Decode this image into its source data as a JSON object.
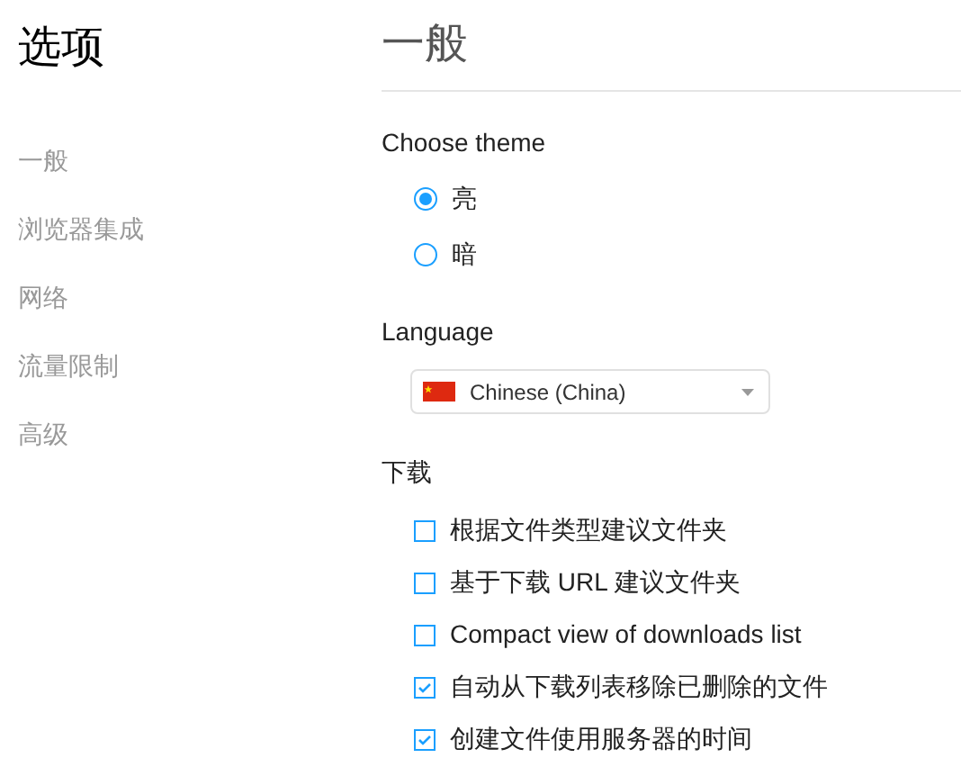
{
  "sidebar": {
    "title": "选项",
    "items": [
      {
        "label": "一般"
      },
      {
        "label": "浏览器集成"
      },
      {
        "label": "网络"
      },
      {
        "label": "流量限制"
      },
      {
        "label": "高级"
      }
    ]
  },
  "page": {
    "title": "一般",
    "theme": {
      "label": "Choose theme",
      "options": [
        {
          "label": "亮",
          "selected": true
        },
        {
          "label": "暗",
          "selected": false
        }
      ]
    },
    "language": {
      "label": "Language",
      "value": "Chinese (China)"
    },
    "downloads": {
      "label": "下载",
      "options": [
        {
          "label": "根据文件类型建议文件夹",
          "checked": false
        },
        {
          "label": "基于下载 URL 建议文件夹",
          "checked": false
        },
        {
          "label": "Compact view of downloads list",
          "checked": false
        },
        {
          "label": "自动从下载列表移除已删除的文件",
          "checked": true
        },
        {
          "label": "创建文件使用服务器的时间",
          "checked": true
        }
      ]
    }
  }
}
